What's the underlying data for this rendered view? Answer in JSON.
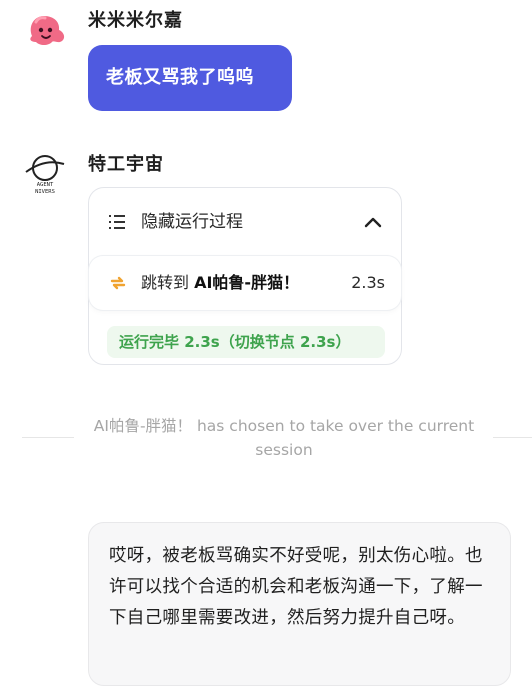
{
  "user": {
    "name": "米米米尔嘉",
    "message": "老板又骂我了呜呜"
  },
  "bot": {
    "name": "特工宇宙",
    "avatar_text": [
      "AGENT",
      "NIVERS"
    ]
  },
  "run_card": {
    "title": "隐藏运行过程",
    "step": {
      "prefix": "跳转到 ",
      "target": "AI帕鲁-胖猫！",
      "duration": "2.3s"
    },
    "status": "运行完毕 2.3s（切换节点 2.3s）"
  },
  "notice": "AI帕鲁-胖猫！  has chosen to take over the current session",
  "reply": "哎呀，被老板骂确实不好受呢，别太伤心啦。也许可以找个合适的机会和老板沟通一下，了解一下自己哪里需要改进，然后努力提升自己呀。",
  "colors": {
    "user_bubble": "#4f5ae0",
    "status_green": "#3ea34d",
    "switch_orange": "#f0a330"
  },
  "icons": {
    "user_avatar": "pink-blob-avatar",
    "bot_avatar": "planet-avatar",
    "list": "list-icon",
    "collapse": "chevron-up-icon",
    "switch": "switch-arrows-icon"
  }
}
